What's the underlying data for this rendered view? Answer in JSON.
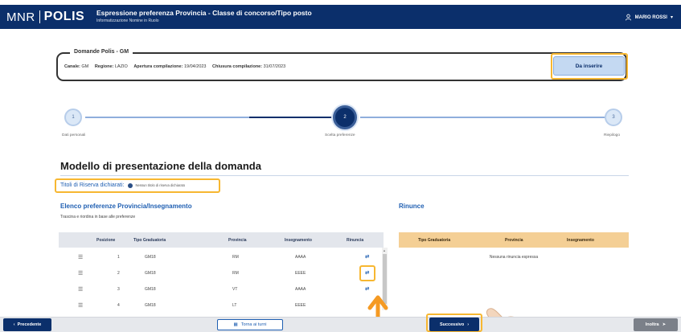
{
  "header": {
    "logo_left": "MNR",
    "logo_right": "POLIS",
    "title": "Espressione preferenza Provincia - Classe di concorso/Tipo posto",
    "subtitle": "Informatizzazione Nomine in Ruolo",
    "user": "MARIO ROSSI"
  },
  "domande": {
    "legend": "Domande Polis - GM",
    "canale_label": "Canale:",
    "canale_value": "GM",
    "regione_label": "Regione:",
    "regione_value": "LAZIO",
    "apertura_label": "Apertura compilazione:",
    "apertura_value": "19/04/2023",
    "chiusura_label": "Chiusura compilazione:",
    "chiusura_value": "31/07/2023",
    "status_button": "Da inserire"
  },
  "stepper": {
    "steps": [
      {
        "number": "1",
        "label": "Dati personali"
      },
      {
        "number": "2",
        "label": "Scelta preferenze"
      },
      {
        "number": "3",
        "label": "Riepilogo"
      }
    ],
    "current": 2
  },
  "main": {
    "title": "Modello di presentazione della domanda",
    "titoli_label": "Titoli di Riserva dichiarati:",
    "titoli_value": "Nessun titolo di riserva dichiarato",
    "elenco_title": "Elenco preferenze Provincia/Insegnamento",
    "elenco_sub": "Trascina e riordina in base alle preferenze",
    "rinunce_title": "Rinunce"
  },
  "preferences_table": {
    "columns": [
      "Posizione",
      "Tipo Graduatoria",
      "Provincia",
      "Insegnamento",
      "Rinuncia"
    ],
    "rows": [
      {
        "posizione": "1",
        "tipo": "GM18",
        "provincia": "RM",
        "insegnamento": "AAAA"
      },
      {
        "posizione": "2",
        "tipo": "GM18",
        "provincia": "RM",
        "insegnamento": "EEEE"
      },
      {
        "posizione": "3",
        "tipo": "GM18",
        "provincia": "VT",
        "insegnamento": "AAAA"
      },
      {
        "posizione": "4",
        "tipo": "GM18",
        "provincia": "LT",
        "insegnamento": "EEEE"
      }
    ],
    "rinuncia_icon": "swap-icon",
    "drag_icon": "drag-handle-icon"
  },
  "rinunce_table": {
    "columns": [
      "Tipo Graduatoria",
      "Provincia",
      "Insegnamento"
    ],
    "empty": "Nessuna rinuncia espressa"
  },
  "footer": {
    "precedente": "Precedente",
    "turni": "Torna ai turni",
    "successivo": "Successivo",
    "invia": "Inoltra"
  },
  "colors": {
    "primary": "#0b2f6b",
    "highlight": "#f7b731",
    "link": "#1f5fb2",
    "rinunce_header": "#f4cf95"
  }
}
